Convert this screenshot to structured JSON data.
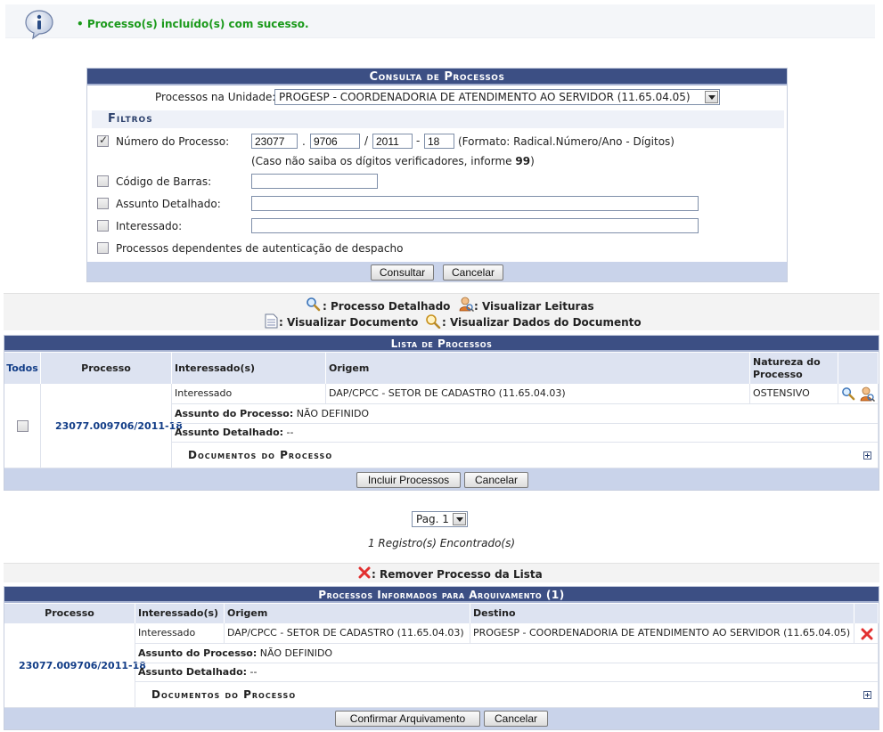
{
  "message": {
    "text": "• Processo(s) incluído(s) com sucesso."
  },
  "consulta": {
    "title": "Consulta de Processos",
    "unidade_label": "Processos na Unidade:",
    "unidade_value": "PROGESP - COORDENADORIA DE ATENDIMENTO AO SERVIDOR (11.65.04.05)",
    "filtros_title": "Filtros",
    "numero_label": "Número do Processo:",
    "numero": {
      "radical": "23077",
      "numero": "9706",
      "ano": "2011",
      "digitos": "18"
    },
    "sep_dot": ".",
    "sep_slash": "/",
    "sep_dash": "-",
    "formato": "(Formato: Radical.Número/Ano - Dígitos)",
    "hint_prefix": "(Caso não saiba os dígitos verificadores, informe ",
    "hint_bold": "99",
    "hint_suffix": ")",
    "codigo_label": "Código de Barras:",
    "assunto_label": "Assunto Detalhado:",
    "interessado_label": "Interessado:",
    "dependentes_label": "Processos dependentes de autenticação de despacho",
    "consultar": "Consultar",
    "cancelar": "Cancelar"
  },
  "legend": {
    "detalhado": ": Processo Detalhado",
    "leituras": ": Visualizar Leituras",
    "documento": ": Visualizar Documento",
    "dados": ": Visualizar Dados do Documento",
    "remover": ": Remover Processo da Lista"
  },
  "lista": {
    "title": "Lista de Processos",
    "headers": {
      "todos": "Todos",
      "processo": "Processo",
      "interessados": "Interessado(s)",
      "origem": "Origem",
      "natureza_1": "Natureza do",
      "natureza_2": "Processo"
    },
    "row": {
      "processo": "23077.009706/2011-18",
      "interessado": "Interessado",
      "origem": "DAP/CPCC - SETOR DE CADASTRO (11.65.04.03)",
      "natureza": "OSTENSIVO",
      "assunto_label": "Assunto do Processo:",
      "assunto_value": "NÃO DEFINIDO",
      "detalhado_label": "Assunto Detalhado:",
      "detalhado_value": "--",
      "documentos": "Documentos do Processo"
    },
    "incluir": "Incluir Processos",
    "cancelar": "Cancelar"
  },
  "pager": {
    "value": "Pag. 1",
    "count": "1 Registro(s) Encontrado(s)"
  },
  "arquivamento": {
    "title": "Processos Informados para Arquivamento (1)",
    "headers": {
      "processo": "Processo",
      "interessados": "Interessado(s)",
      "origem": "Origem",
      "destino": "Destino"
    },
    "row": {
      "processo": "23077.009706/2011-18",
      "interessado": "Interessado",
      "origem": "DAP/CPCC - SETOR DE CADASTRO (11.65.04.03)",
      "destino": "PROGESP - COORDENADORIA DE ATENDIMENTO AO SERVIDOR (11.65.04.05)",
      "assunto_label": "Assunto do Processo:",
      "assunto_value": "NÃO DEFINIDO",
      "detalhado_label": "Assunto Detalhado:",
      "detalhado_value": "--",
      "documentos": "Documentos do Processo"
    },
    "confirmar": "Confirmar Arquivamento",
    "cancelar": "Cancelar"
  },
  "icons": [
    "info-icon",
    "magnifier-icon",
    "reader-icon",
    "document-icon",
    "document-magnifier-icon",
    "remove-x-icon",
    "expand-plus-icon"
  ]
}
